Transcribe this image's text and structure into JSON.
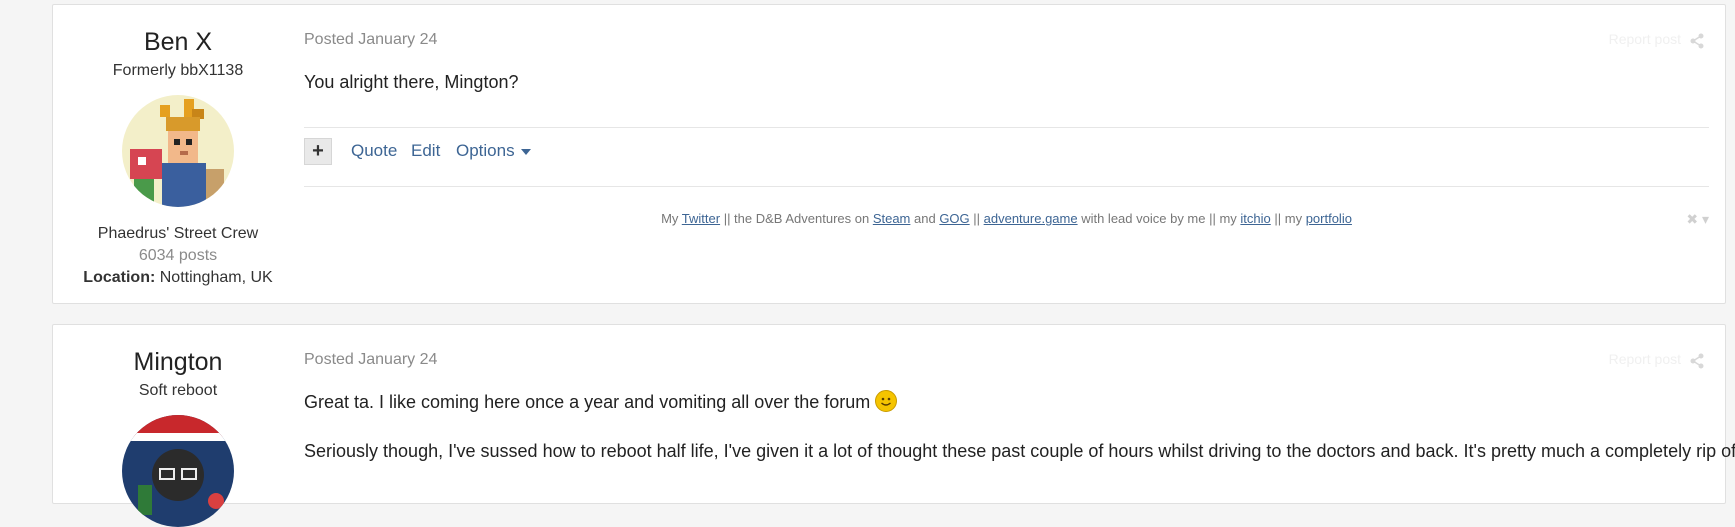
{
  "posts": [
    {
      "author": {
        "name": "Ben X",
        "title": "Formerly bbX1138",
        "group": "Phaedrus' Street Crew",
        "post_count": "6034 posts",
        "location_label": "Location:",
        "location_value": "Nottingham, UK"
      },
      "posted": "Posted January 24",
      "report": "Report post",
      "body": "You alright there, Mington?",
      "actions": {
        "plus": "+",
        "quote": "Quote",
        "edit": "Edit",
        "options": "Options"
      },
      "signature": {
        "t1": "My ",
        "twitter": "Twitter",
        "t2": " || the D&B Adventures on ",
        "steam": "Steam",
        "t3": " and ",
        "gog": "GOG",
        "t4": " || ",
        "adventure": "adventure.game",
        "t5": " with lead voice by me || my ",
        "itchio": "itchio",
        "t6": " || my ",
        "portfolio": "portfolio"
      }
    },
    {
      "author": {
        "name": "Mington",
        "title": "Soft reboot"
      },
      "posted": "Posted January 24",
      "report": "Report post",
      "body_1": "Great ta. I like coming here once a year and vomiting all over the forum",
      "body_2": "Seriously though, I've sussed how to reboot half life, I've given it a lot of thought these past couple of hours whilst driving to the doctors and back. It's pretty much a completely rip off"
    }
  ],
  "colors": {
    "link": "#3d6594",
    "muted": "#8a8a8a",
    "background": "#f5f5f5"
  }
}
